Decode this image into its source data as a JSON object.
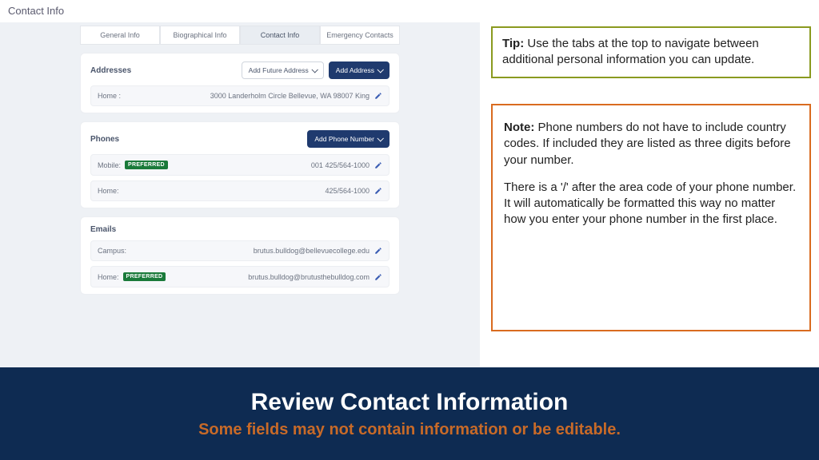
{
  "page_title": "Contact Info",
  "tabs": [
    {
      "label": "General Info"
    },
    {
      "label": "Biographical Info"
    },
    {
      "label": "Contact Info"
    },
    {
      "label": "Emergency Contacts"
    }
  ],
  "addresses": {
    "title": "Addresses",
    "future_btn": "Add Future Address",
    "add_btn": "Add Address",
    "items": [
      {
        "type": "Home :",
        "value": "3000 Landerholm Circle Bellevue, WA 98007 King"
      }
    ]
  },
  "phones": {
    "title": "Phones",
    "add_btn": "Add Phone Number",
    "items": [
      {
        "type": "Mobile:",
        "preferred": "PREFERRED",
        "value": "001 425/564-1000"
      },
      {
        "type": "Home:",
        "value": "425/564-1000"
      }
    ]
  },
  "emails": {
    "title": "Emails",
    "items": [
      {
        "type": "Campus:",
        "value": "brutus.bulldog@bellevuecollege.edu"
      },
      {
        "type": "Home:",
        "preferred": "PREFERRED",
        "value": "brutus.bulldog@brutusthebulldog.com"
      }
    ]
  },
  "tip": {
    "label": "Tip:",
    "text": " Use the tabs at the top to navigate between additional personal information you can update."
  },
  "note": {
    "label": "Note:",
    "p1": " Phone numbers do not have to include country codes. If included they are listed as three digits before your number.",
    "p2": "There is a '/' after the area code of your phone number. It will automatically be formatted this way no matter how you enter your phone number in the first place."
  },
  "banner": {
    "title": "Review Contact Information",
    "subtitle": "Some fields may not contain information or be editable."
  }
}
